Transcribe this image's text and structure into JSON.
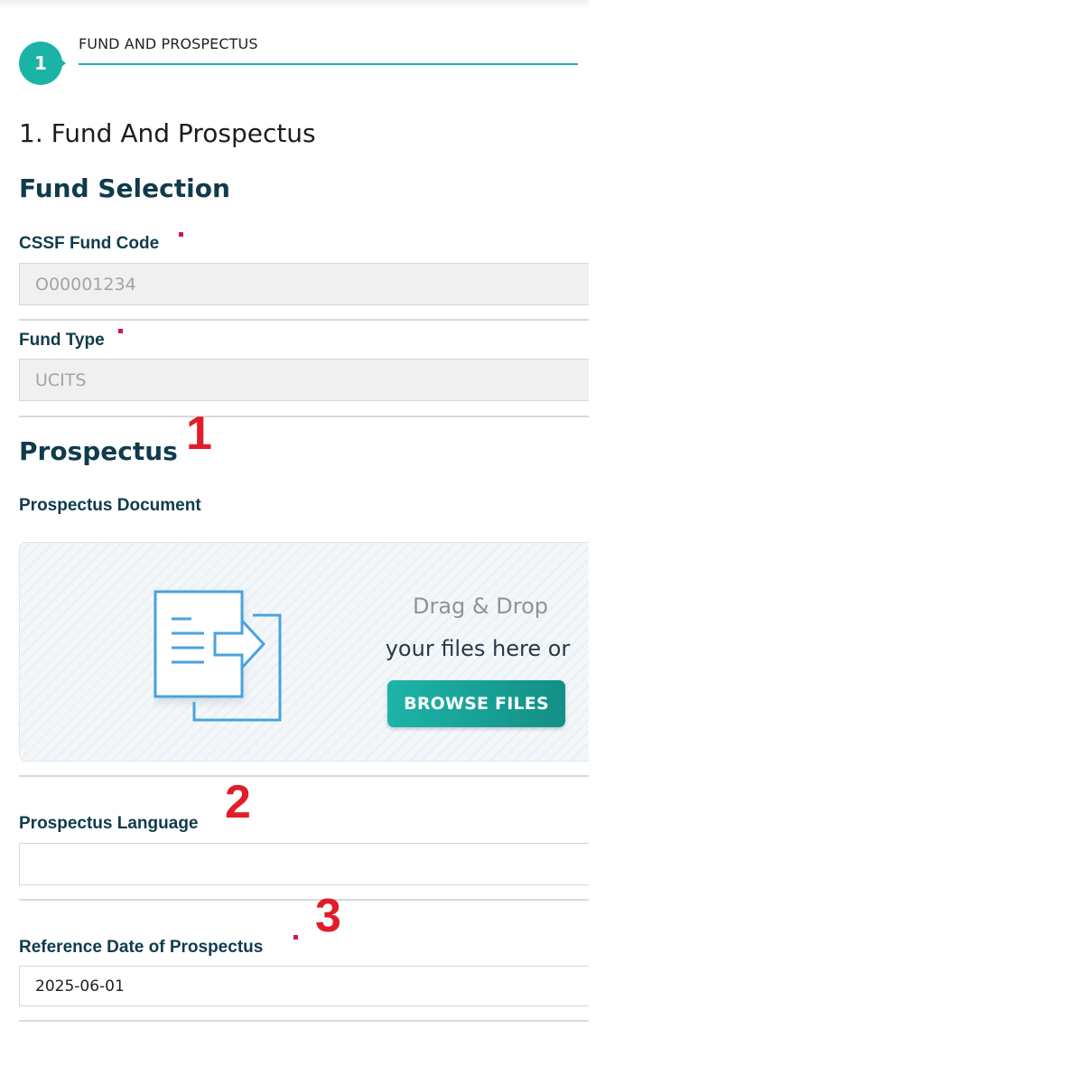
{
  "stepper": {
    "step_number": "1",
    "step_label": "FUND AND PROSPECTUS",
    "accent_color": "#1bb3a6"
  },
  "page": {
    "title": "1. Fund And Prospectus"
  },
  "fund_selection": {
    "heading": "Fund Selection",
    "cssf_code": {
      "label": "CSSF Fund Code",
      "required": true,
      "value": "O00001234"
    },
    "fund_type": {
      "label": "Fund Type",
      "required": true,
      "value": "UCITS"
    }
  },
  "prospectus": {
    "heading": "Prospectus",
    "document": {
      "label": "Prospectus Document",
      "drop_line1": "Drag & Drop",
      "drop_line2": "your files here or",
      "browse_label": "BROWSE FILES",
      "icon": "document-transfer-icon"
    },
    "language": {
      "label": "Prospectus Language",
      "value": ""
    },
    "reference_date": {
      "label": "Reference Date of Prospectus",
      "required": true,
      "value": "2025-06-01"
    }
  },
  "annotations": [
    "1",
    "2",
    "3"
  ],
  "colors": {
    "required_marker": "#d4145a",
    "annotation": "#e11d2a",
    "heading": "#0f3b4c"
  }
}
